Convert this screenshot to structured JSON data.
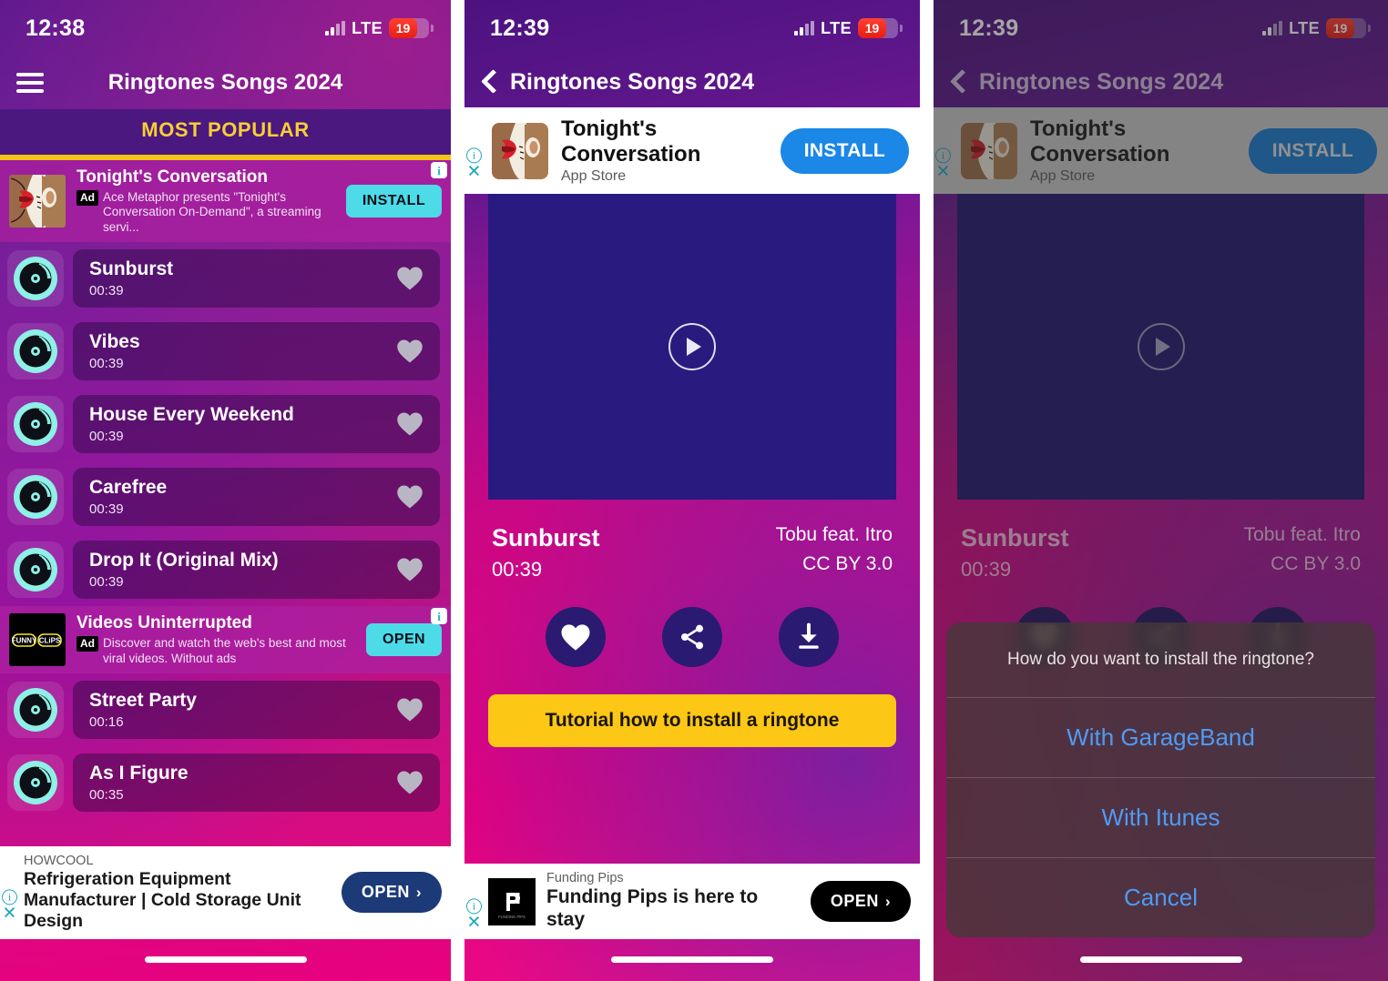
{
  "app": {
    "name": "Ringtones Songs 2024"
  },
  "panels": {
    "list": {
      "status": {
        "time": "12:38",
        "network": "LTE",
        "battery": "19"
      },
      "nav": {
        "title": "Ringtones Songs 2024",
        "menu_icon": "hamburger-menu-icon"
      },
      "section_header": "MOST POPULAR",
      "ads": [
        {
          "title": "Tonight's Conversation",
          "badge": "Ad",
          "description": "Ace Metaphor presents \"Tonight's Conversation On-Demand\", a streaming servi...",
          "cta": "INSTALL"
        },
        {
          "title": "Videos Uninterrupted",
          "badge": "Ad",
          "description": "Discover and watch the web's best and most viral videos. Without ads",
          "cta": "OPEN"
        }
      ],
      "songs_top": [
        {
          "name": "Sunburst",
          "duration": "00:39"
        },
        {
          "name": "Vibes",
          "duration": "00:39"
        },
        {
          "name": "House Every Weekend",
          "duration": "00:39"
        },
        {
          "name": "Carefree",
          "duration": "00:39"
        },
        {
          "name": "Drop It (Original Mix)",
          "duration": "00:39"
        }
      ],
      "songs_bottom": [
        {
          "name": "Street Party",
          "duration": "00:16"
        },
        {
          "name": "As I Figure",
          "duration": "00:35"
        }
      ],
      "banner": {
        "brand": "HOWCOOL",
        "headline": "Refrigeration Equipment Manufacturer | Cold Storage Unit Design",
        "cta": "OPEN",
        "cta_chevron": "›"
      }
    },
    "detail": {
      "status": {
        "time": "12:39",
        "network": "LTE",
        "battery": "19"
      },
      "nav": {
        "title": "Ringtones Songs 2024",
        "back_icon": "chevron-left-icon"
      },
      "gad": {
        "title": "Tonight's Conversation",
        "subtitle": "App Store",
        "cta": "INSTALL"
      },
      "player": {
        "play_icon": "play-circle-icon"
      },
      "song": {
        "name": "Sunburst",
        "duration": "00:39",
        "artist": "Tobu feat. Itro",
        "license": "CC BY 3.0"
      },
      "actions": [
        {
          "icon": "heart-icon",
          "name": "favorite"
        },
        {
          "icon": "share-icon",
          "name": "share"
        },
        {
          "icon": "download-icon",
          "name": "download"
        }
      ],
      "tutorial_button": "Tutorial how to install a ringtone",
      "banner": {
        "brand": "Funding Pips",
        "headline": "Funding Pips is here to stay",
        "cta": "OPEN",
        "cta_chevron": "›"
      }
    },
    "dialog": {
      "status": {
        "time": "12:39",
        "network": "LTE",
        "battery": "19"
      },
      "nav": {
        "title": "Ringtones Songs 2024",
        "back_icon": "chevron-left-icon"
      },
      "gad": {
        "title": "Tonight's Conversation",
        "subtitle": "App Store",
        "cta": "INSTALL"
      },
      "song": {
        "name": "Sunburst",
        "duration": "00:39",
        "artist": "Tobu feat. Itro",
        "license": "CC BY 3.0"
      },
      "action_sheet": {
        "title": "How do you want to install the ringtone?",
        "options": [
          "With GarageBand",
          "With Itunes"
        ],
        "cancel": "Cancel"
      }
    }
  },
  "colors": {
    "accent_yellow": "#f5c518",
    "section_text": "#f7cf35",
    "cyan_cta": "#4ddbe8",
    "blue_cta": "#1b87e6",
    "navy_cta": "#1c3a78",
    "sheet_link": "#4e9bf5",
    "disc_cyan": "#8ef0e6",
    "tutorial_yellow": "#fcc715"
  }
}
